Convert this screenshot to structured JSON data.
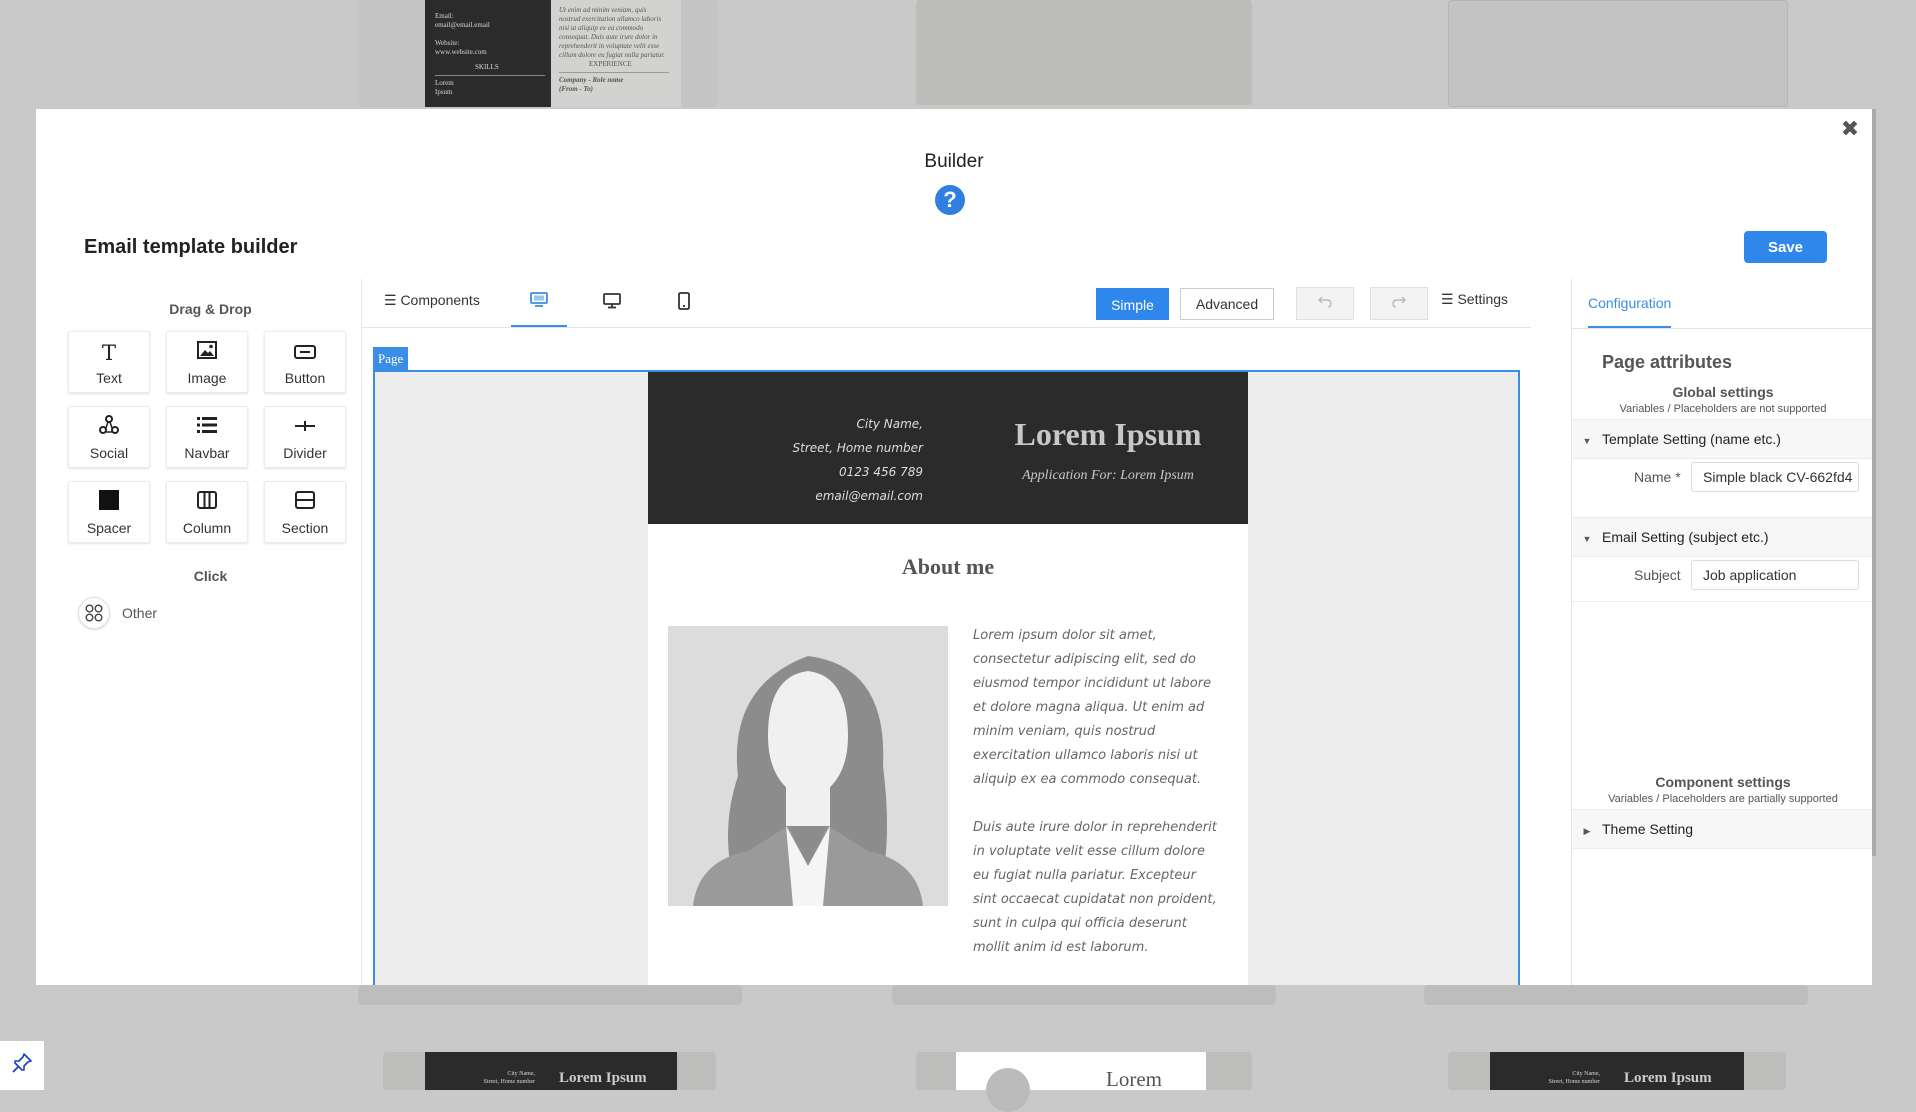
{
  "background": {
    "top_left_card": {
      "left_lines": [
        "Email:",
        "email@email.email",
        "",
        "Website:",
        "www.website.com"
      ],
      "skills": "SKILLS",
      "skill_items": [
        "Lorem",
        "Ipsum"
      ],
      "right_lines": [
        "Ut enim ad minim veniam, quis",
        "nostrud exercitation ullamco laboris",
        "nisi ut aliquip ex ea commodo",
        "consequat. Duis aute irure dolor in",
        "reprehenderit in voluptate velit esse",
        "cillum dolore eu fugiat nulla pariatur."
      ],
      "experience": "EXPERIENCE",
      "company": "Company - Role name",
      "from_to": "(From - To)"
    },
    "bottom_cards": [
      {
        "name": "Lorem Ipsum",
        "lines": [
          "City Name,",
          "Street, Home number"
        ]
      },
      {
        "name": "Lorem"
      },
      {
        "name": "Lorem Ipsum",
        "lines": [
          "City Name,",
          "Street, Home number"
        ]
      }
    ]
  },
  "modal": {
    "title": "Builder",
    "close_icon": "close-icon",
    "help_icon": "help-icon"
  },
  "header": {
    "title": "Email template builder",
    "save_label": "Save"
  },
  "left_panel": {
    "drag_drop_title": "Drag & Drop",
    "blocks": [
      {
        "label": "Text",
        "icon": "text-icon"
      },
      {
        "label": "Image",
        "icon": "image-icon"
      },
      {
        "label": "Button",
        "icon": "button-icon"
      },
      {
        "label": "Social",
        "icon": "social-icon"
      },
      {
        "label": "Navbar",
        "icon": "navbar-icon"
      },
      {
        "label": "Divider",
        "icon": "divider-icon"
      },
      {
        "label": "Spacer",
        "icon": "spacer-icon"
      },
      {
        "label": "Column",
        "icon": "column-icon"
      },
      {
        "label": "Section",
        "icon": "section-icon"
      }
    ],
    "click_title": "Click",
    "other_label": "Other"
  },
  "toolbar": {
    "components_label": "☰ Components",
    "devices": [
      "desktop-pc-icon",
      "desktop-icon",
      "mobile-icon"
    ],
    "simple_label": "Simple",
    "advanced_label": "Advanced",
    "undo_icon": "undo-icon",
    "redo_icon": "redo-icon",
    "settings_label": "☰ Settings"
  },
  "canvas": {
    "page_tag": "Page",
    "email": {
      "contact": [
        "City Name,",
        "Street, Home number",
        "0123 456 789",
        "email@email.com"
      ],
      "name": "Lorem Ipsum",
      "application": "Application For: Lorem Ipsum",
      "about_title": "About me",
      "paragraph1": "Lorem ipsum dolor sit amet, consectetur adipiscing elit, sed do eiusmod tempor incididunt ut labore et dolore magna aliqua. Ut enim ad minim veniam, quis nostrud exercitation ullamco laboris nisi ut aliquip ex ea commodo consequat.",
      "paragraph2": "Duis aute irure dolor in reprehenderit in voluptate velit esse cillum dolore eu fugiat nulla pariatur. Excepteur sint occaecat cupidatat non proident, sunt in culpa qui officia deserunt mollit anim id est laborum."
    }
  },
  "right_panel": {
    "tab": "Configuration",
    "page_attributes": "Page attributes",
    "global_settings": "Global settings",
    "global_note": "Variables / Placeholders are not supported",
    "template_setting": "Template Setting (name etc.)",
    "name_label": "Name *",
    "name_value": "Simple black CV-662fd4",
    "email_setting": "Email Setting (subject etc.)",
    "subject_label": "Subject",
    "subject_value": "Job application",
    "component_settings": "Component settings",
    "component_note": "Variables / Placeholders are partially supported",
    "theme_setting": "Theme Setting"
  }
}
